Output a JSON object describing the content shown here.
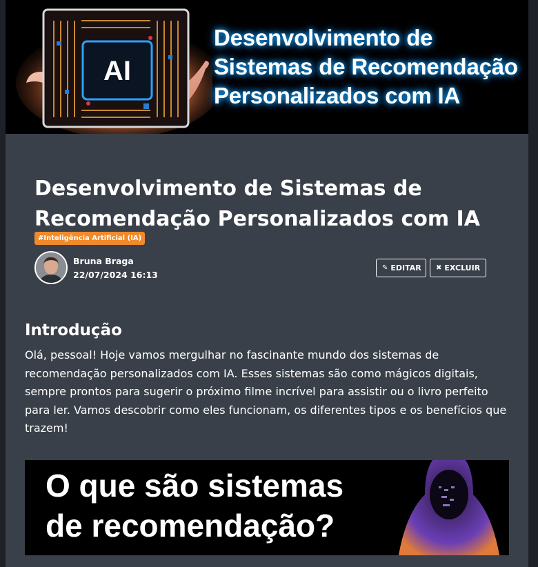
{
  "hero": {
    "title_lines": [
      "Desenvolvimento de",
      "Sistemas de Recomendação",
      "Personalizados com IA"
    ],
    "chip_label": "AI"
  },
  "post": {
    "title": "Desenvolvimento de Sistemas de Recomendação Personalizados com IA",
    "tag": "#Inteligência Artificial (IA)",
    "author": "Bruna Braga",
    "date": "22/07/2024 16:13",
    "edit_label": "EDITAR",
    "delete_label": "EXCLUIR"
  },
  "content": {
    "heading": "Introdução",
    "paragraph": "Olá, pessoal! Hoje vamos mergulhar no fascinante mundo dos sistemas de recomendação personalizados com IA. Esses sistemas são como mágicos digitais, sempre prontos para sugerir o próximo filme incrível para assistir ou o livro perfeito para ler. Vamos descobrir como eles funcionam, os diferentes tipos e os benefícios que trazem!",
    "banner_lines": [
      "O que são sistemas",
      "de recomendação?"
    ]
  },
  "colors": {
    "page_bg": "#3a4049",
    "tag_bg": "#f08a2b",
    "hero_glow": "#19a7ff"
  },
  "icons": {
    "edit": "pencil-icon",
    "delete": "times-icon"
  }
}
